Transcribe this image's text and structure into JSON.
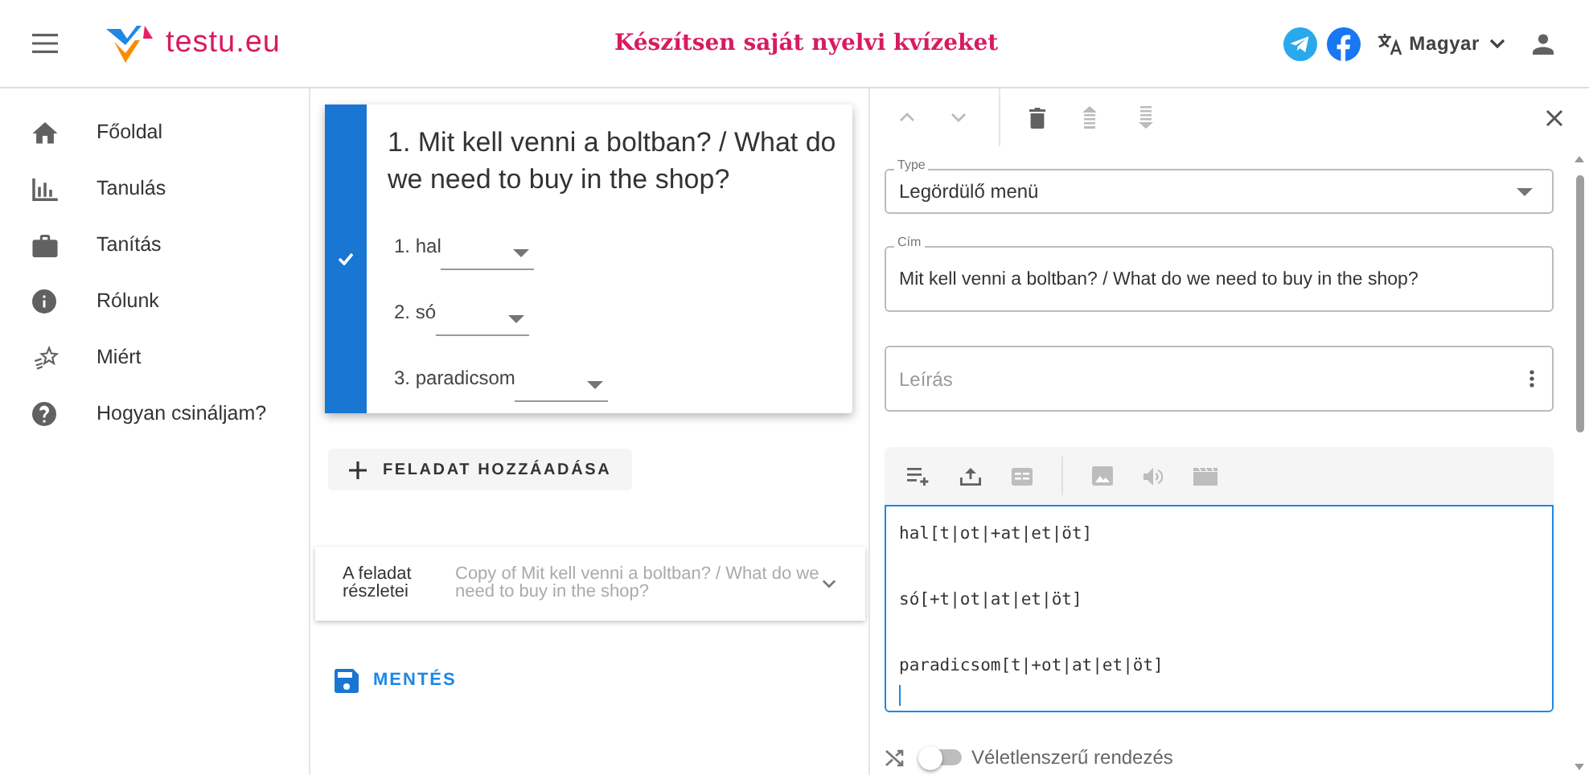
{
  "header": {
    "brand": "testu.eu",
    "title": "Készítsen saját nyelvi kvízeket",
    "language": "Magyar"
  },
  "sidebar": {
    "items": [
      {
        "label": "Főoldal",
        "kind": "home"
      },
      {
        "label": "Tanulás",
        "kind": "chart"
      },
      {
        "label": "Tanítás",
        "kind": "briefcase"
      },
      {
        "label": "Rólunk",
        "kind": "info"
      },
      {
        "label": "Miért",
        "kind": "stars"
      },
      {
        "label": "Hogyan csináljam?",
        "kind": "help"
      }
    ]
  },
  "question_card": {
    "selected": true,
    "title": "1. Mit kell venni a boltban? / What do we need to buy in the shop?",
    "blanks": [
      {
        "label": "1. hal"
      },
      {
        "label": "2. só"
      },
      {
        "label": "3. paradicsom"
      }
    ]
  },
  "add_task_button": "FELADAT HOZZÁADÁSA",
  "details": {
    "label": "A feladat részletei",
    "value": "Copy of Mit kell venni a boltban? / What do we need to buy in the shop?"
  },
  "save_button": "MENTÉS",
  "editor": {
    "type_field": {
      "label": "Type",
      "value": "Legördülő menü"
    },
    "title_field": {
      "label": "Cím",
      "value": "Mit kell venni a boltban? / What do we need to buy in the shop?"
    },
    "description_field": {
      "placeholder": "Leírás"
    },
    "content_lines": [
      "hal[t|ot|+at|et|öt]",
      "só[+t|ot|at|et|öt]",
      "paradicsom[t|+ot|at|et|öt]"
    ],
    "shuffle": {
      "label": "Véletlenszerű rendezés",
      "on": false
    }
  }
}
